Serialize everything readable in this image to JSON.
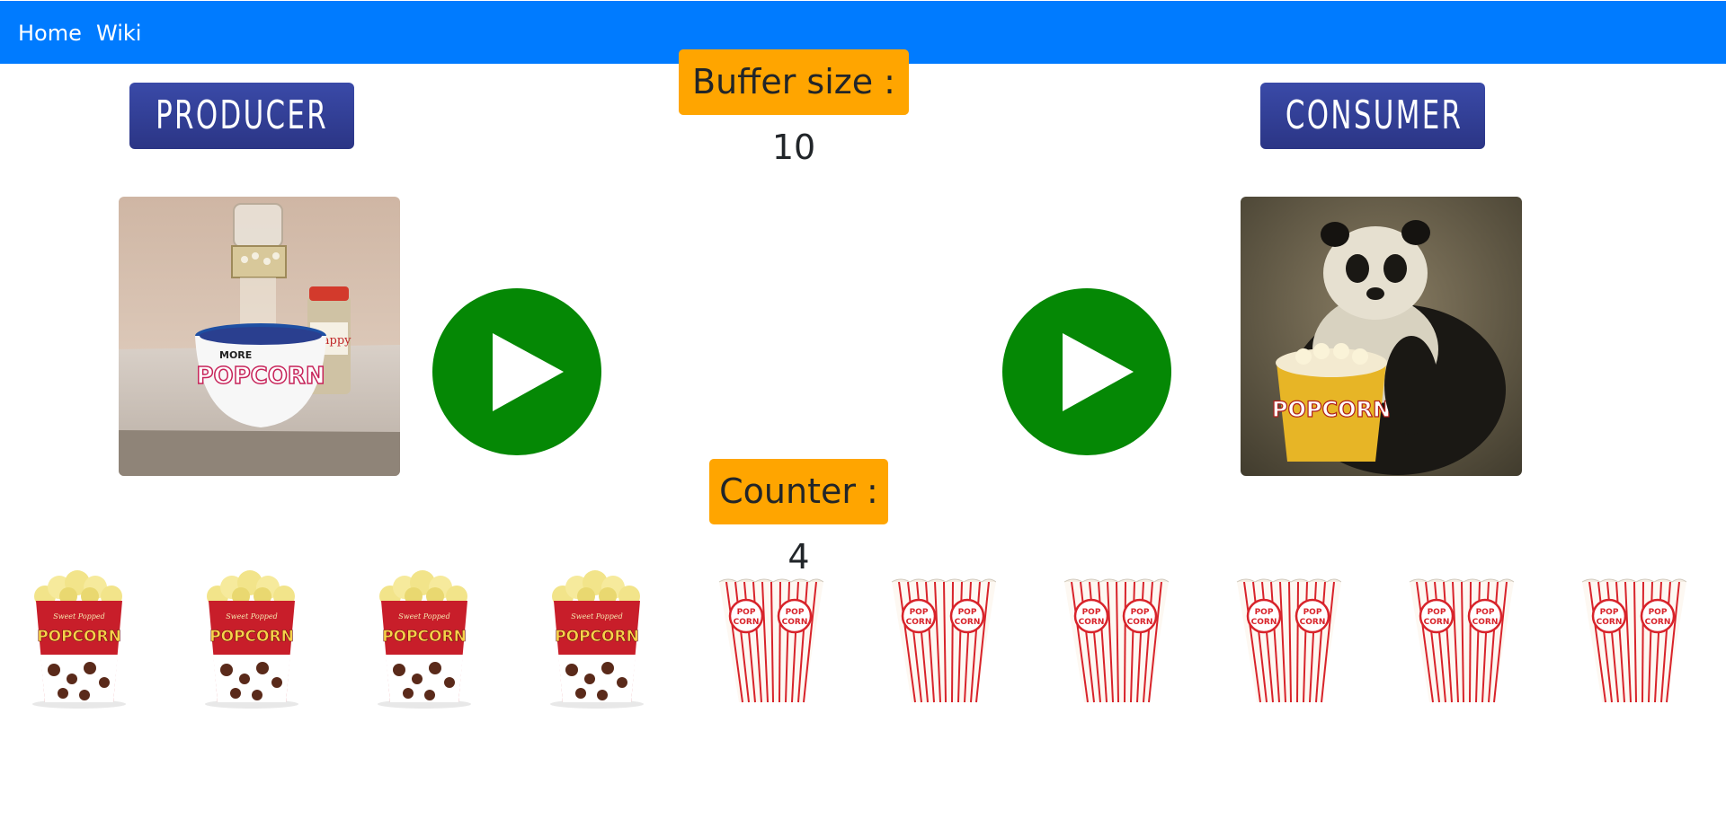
{
  "nav": {
    "home": "Home",
    "wiki": "Wiki"
  },
  "producer": {
    "label": "PRODUCER",
    "bowl_text": "POPCORN",
    "bowl_prefix": "MORE",
    "jar_text": "Snappy"
  },
  "consumer": {
    "label": "CONSUMER",
    "bucket_text": "POPCORN"
  },
  "buffer": {
    "text": "Buffer size : 10",
    "size": 10
  },
  "counter": {
    "text": "Counter : 4",
    "count": 4
  },
  "buffer_slots": {
    "filled_label": "POPCORN",
    "filled_small": "Sweet Popped",
    "empty_label_top": "POP",
    "empty_label_bottom": "CORN"
  },
  "colors": {
    "navbar": "#007bff",
    "badge": "#ffa500",
    "play": "#058805",
    "role_button": "#2e3a93"
  },
  "icons": {
    "producer_play": "play-icon",
    "consumer_play": "play-icon"
  }
}
